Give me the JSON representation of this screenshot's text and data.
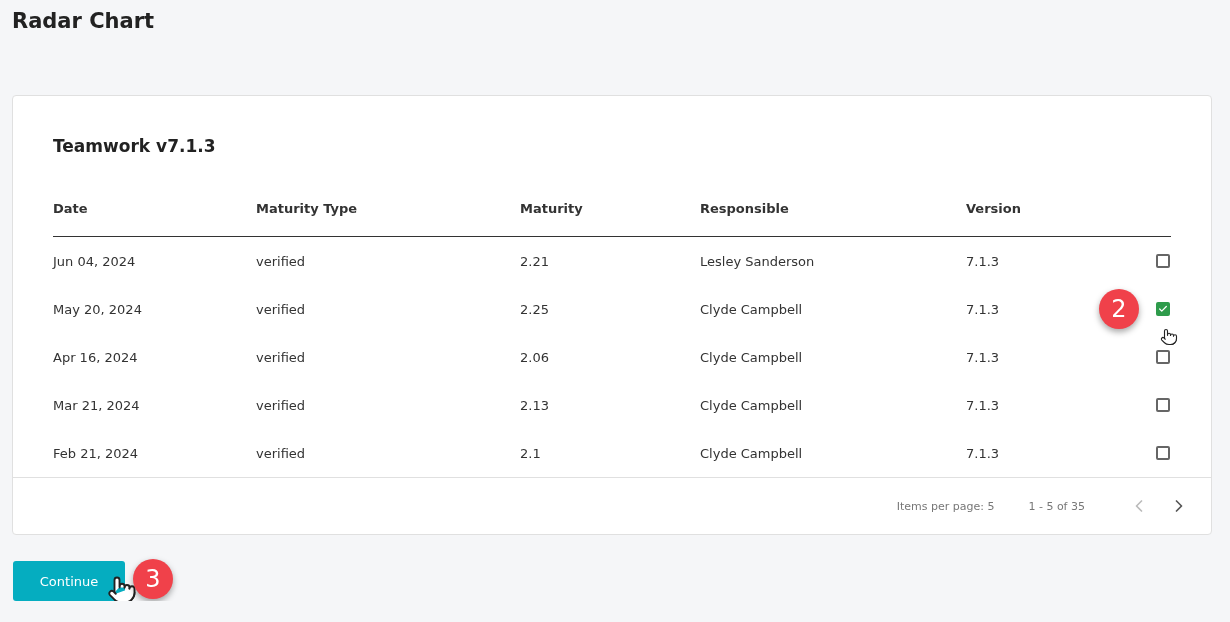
{
  "page_title": "Radar Chart",
  "card": {
    "title": "Teamwork v7.1.3",
    "columns": [
      "Date",
      "Maturity Type",
      "Maturity",
      "Responsible",
      "Version"
    ],
    "rows": [
      {
        "cells": [
          "Jun 04, 2024",
          "verified",
          "2.21",
          "Lesley Sanderson",
          "7.1.3"
        ],
        "checked": false
      },
      {
        "cells": [
          "May 20, 2024",
          "verified",
          "2.25",
          "Clyde Campbell",
          "7.1.3"
        ],
        "checked": true,
        "step": "2"
      },
      {
        "cells": [
          "Apr 16, 2024",
          "verified",
          "2.06",
          "Clyde Campbell",
          "7.1.3"
        ],
        "checked": false
      },
      {
        "cells": [
          "Mar 21, 2024",
          "verified",
          "2.13",
          "Clyde Campbell",
          "7.1.3"
        ],
        "checked": false
      },
      {
        "cells": [
          "Feb 21, 2024",
          "verified",
          "2.1",
          "Clyde Campbell",
          "7.1.3"
        ],
        "checked": false
      }
    ],
    "paginator": {
      "items_per_page": "Items per page: 5",
      "range": "1 - 5 of 35",
      "prev_disabled": true,
      "next_disabled": false
    }
  },
  "continue_button": {
    "label": "Continue",
    "step": "3"
  }
}
